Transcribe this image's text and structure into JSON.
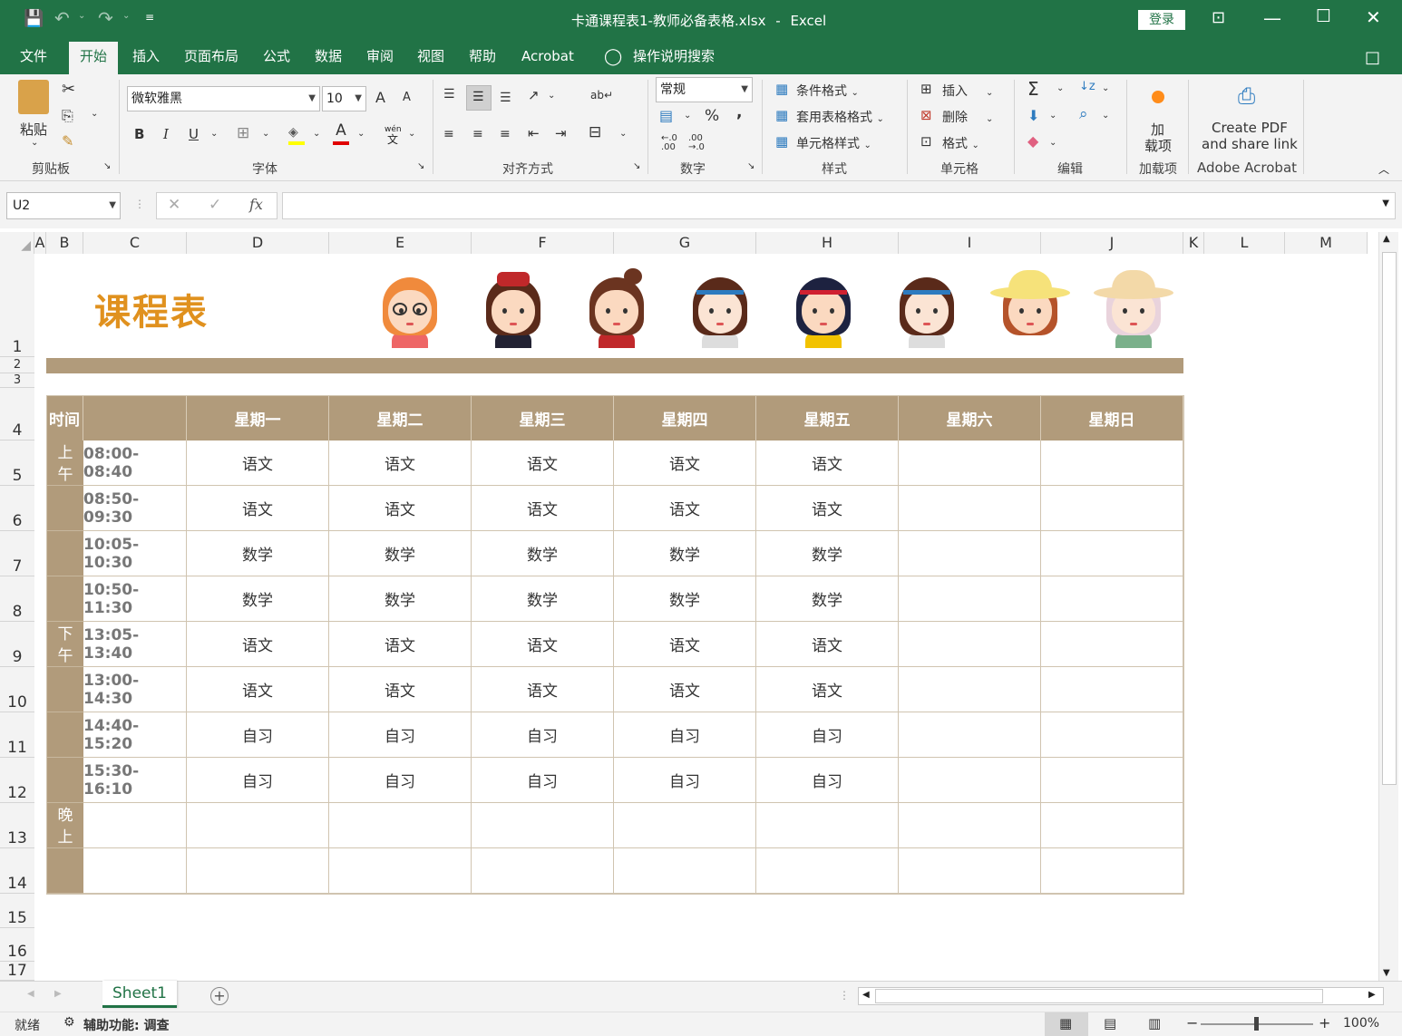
{
  "titlebar": {
    "filename": "卡通课程表1-教师必备表格.xlsx",
    "separator": "-",
    "app": "Excel",
    "login": "登录",
    "save_icon": "save-icon",
    "undo_icon": "undo-icon",
    "redo_icon": "redo-icon",
    "customize_icon": "customize-icon",
    "ribbon_display_icon": "ribbon-display-icon",
    "minimize_icon": "minimize-icon",
    "maximize_icon": "maximize-icon",
    "close_icon": "close-icon"
  },
  "tabs": [
    "文件",
    "开始",
    "插入",
    "页面布局",
    "公式",
    "数据",
    "审阅",
    "视图",
    "帮助",
    "Acrobat"
  ],
  "active_tab": "开始",
  "tell_me": "操作说明搜索",
  "ribbon": {
    "clipboard": {
      "paste": "粘贴",
      "label": "剪贴板"
    },
    "font": {
      "name": "微软雅黑",
      "size": "10",
      "label": "字体",
      "bold": "B",
      "italic": "I",
      "underline": "U",
      "grow": "A",
      "shrink": "A",
      "color_letter": "A",
      "phonetic": "wén",
      "phonetic2": "文"
    },
    "alignment": {
      "label": "对齐方式"
    },
    "number": {
      "format": "常规",
      "label": "数字",
      "percent": "%",
      "comma": ",",
      "inc": "←.0\n.00",
      "dec": ".00\n→.0"
    },
    "styles": {
      "conditional": "条件格式",
      "table": "套用表格格式",
      "cell": "单元格样式",
      "label": "样式"
    },
    "cells": {
      "insert": "插入",
      "delete": "删除",
      "format": "格式",
      "label": "单元格"
    },
    "editing": {
      "label": "编辑",
      "sigma": "Σ"
    },
    "addins": {
      "line1": "加",
      "line2": "载项",
      "label": "加载项"
    },
    "acrobat": {
      "line1": "Create PDF",
      "line2": "and share link",
      "label": "Adobe Acrobat"
    }
  },
  "formula": {
    "namebox": "U2",
    "fx": "fx",
    "content": ""
  },
  "columns": [
    "A",
    "B",
    "C",
    "D",
    "E",
    "F",
    "G",
    "H",
    "I",
    "J",
    "K",
    "L",
    "M"
  ],
  "rows": [
    "1",
    "2",
    "3",
    "4",
    "5",
    "6",
    "7",
    "8",
    "9",
    "10",
    "11",
    "12",
    "13",
    "14",
    "15",
    "16",
    "17"
  ],
  "sheet": {
    "title": "课程表",
    "time_header": "时间",
    "days": [
      "星期一",
      "星期二",
      "星期三",
      "星期四",
      "星期五",
      "星期六",
      "星期日"
    ],
    "sections": [
      [
        "上",
        "午"
      ],
      [
        "下",
        "午"
      ],
      [
        "晚",
        "上"
      ]
    ],
    "times": [
      "08:00-08:40",
      "08:50-09:30",
      "10:05-10:30",
      "10:50-11:30",
      "13:05-13:40",
      "13:00-14:30",
      "14:40-15:20",
      "15:30-16:10",
      "",
      ""
    ],
    "schedule": [
      [
        "语文",
        "语文",
        "语文",
        "语文",
        "语文",
        "",
        ""
      ],
      [
        "语文",
        "语文",
        "语文",
        "语文",
        "语文",
        "",
        ""
      ],
      [
        "数学",
        "数学",
        "数学",
        "数学",
        "数学",
        "",
        ""
      ],
      [
        "数学",
        "数学",
        "数学",
        "数学",
        "数学",
        "",
        ""
      ],
      [
        "语文",
        "语文",
        "语文",
        "语文",
        "语文",
        "",
        ""
      ],
      [
        "语文",
        "语文",
        "语文",
        "语文",
        "语文",
        "",
        ""
      ],
      [
        "自习",
        "自习",
        "自习",
        "自习",
        "自习",
        "",
        ""
      ],
      [
        "自习",
        "自习",
        "自习",
        "自习",
        "自习",
        "",
        ""
      ],
      [
        "",
        "",
        "",
        "",
        "",
        "",
        ""
      ],
      [
        "",
        "",
        "",
        "",
        "",
        "",
        ""
      ]
    ],
    "colors": {
      "accent": "#b19b7b",
      "title": "#e0911e",
      "excel_green": "#217346"
    }
  },
  "sheet_tabs": {
    "active": "Sheet1",
    "add_icon": "add-sheet-icon"
  },
  "status": {
    "ready": "就绪",
    "accessibility": "辅助功能: 调查",
    "zoom": "100%",
    "minus": "−",
    "plus": "+"
  }
}
